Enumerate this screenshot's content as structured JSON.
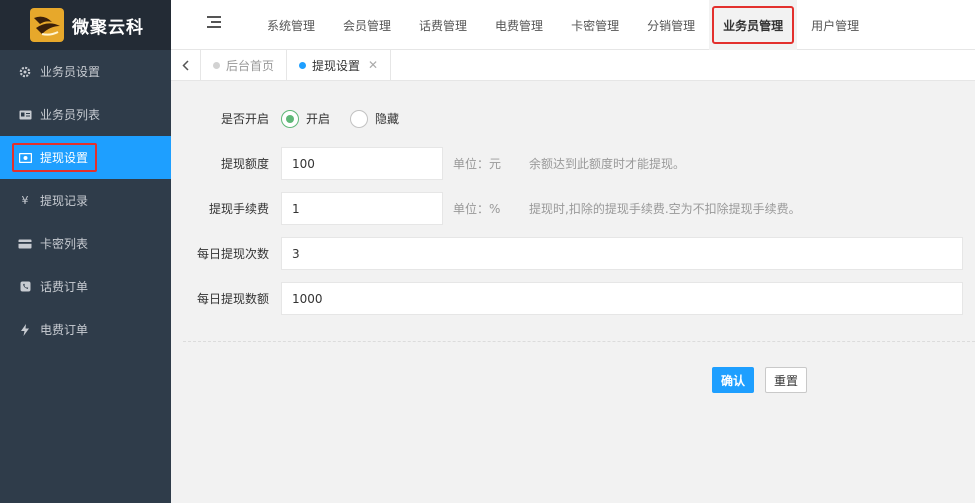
{
  "app": {
    "logo_text": "微聚云科"
  },
  "sidebar": {
    "items": [
      {
        "label": "业务员设置",
        "icon": "gear-icon"
      },
      {
        "label": "业务员列表",
        "icon": "id-card-icon"
      },
      {
        "label": "提现设置",
        "icon": "money-icon",
        "active": true
      },
      {
        "label": "提现记录",
        "icon": "yen-icon"
      },
      {
        "label": "卡密列表",
        "icon": "credit-card-icon"
      },
      {
        "label": "话费订单",
        "icon": "phone-icon"
      },
      {
        "label": "电费订单",
        "icon": "bolt-icon"
      }
    ]
  },
  "topnav": {
    "items": [
      {
        "label": "系统管理"
      },
      {
        "label": "会员管理"
      },
      {
        "label": "话费管理"
      },
      {
        "label": "电费管理"
      },
      {
        "label": "卡密管理"
      },
      {
        "label": "分销管理"
      },
      {
        "label": "业务员管理",
        "active": true
      },
      {
        "label": "用户管理"
      }
    ]
  },
  "tabs": [
    {
      "label": "后台首页"
    },
    {
      "label": "提现设置",
      "active": true
    }
  ],
  "form": {
    "enable": {
      "label": "是否开启",
      "option_on": "开启",
      "option_off": "隐藏"
    },
    "amount": {
      "label": "提现额度",
      "value": "100",
      "unit": "单位：元",
      "hint": "余额达到此额度时才能提现。"
    },
    "fee": {
      "label": "提现手续费",
      "value": "1",
      "unit": "单位：%",
      "hint": "提现时,扣除的提现手续费.空为不扣除提现手续费。"
    },
    "daily_count": {
      "label": "每日提现次数",
      "value": "3"
    },
    "daily_amount": {
      "label": "每日提现数额",
      "value": "1000"
    },
    "submit_label": "确认",
    "reset_label": "重置"
  },
  "colors": {
    "accent": "#1e9fff",
    "sidebar_bg": "#2f3c4a",
    "highlight": "#e3302d",
    "radio_checked": "#5fb878"
  }
}
